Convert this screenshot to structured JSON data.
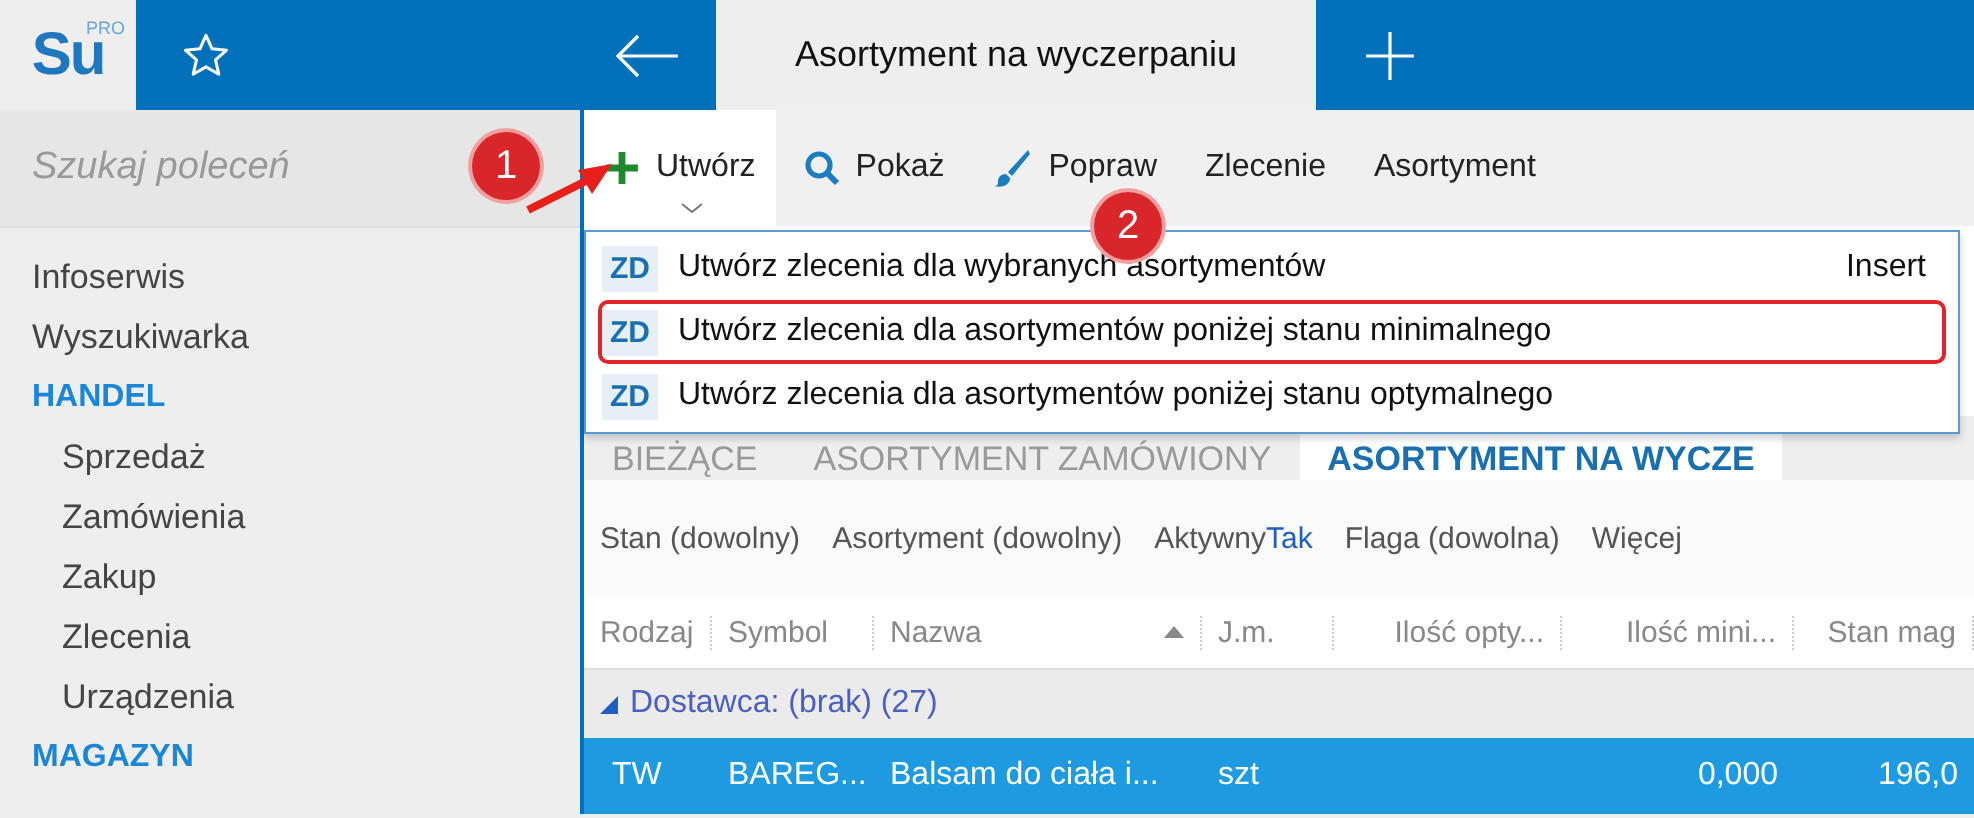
{
  "header": {
    "logo": "Su",
    "logo_badge": "PRO",
    "tab_title": "Asortyment na wyczerpaniu"
  },
  "sidebar": {
    "search": {
      "placeholder": "Szukaj poleceń"
    },
    "items": [
      {
        "kind": "link",
        "label": "Infoserwis"
      },
      {
        "kind": "link",
        "label": "Wyszukiwarka"
      },
      {
        "kind": "section",
        "label": "HANDEL"
      },
      {
        "kind": "sub",
        "label": "Sprzedaż"
      },
      {
        "kind": "sub",
        "label": "Zamówienia"
      },
      {
        "kind": "sub",
        "label": "Zakup"
      },
      {
        "kind": "sub",
        "label": "Zlecenia"
      },
      {
        "kind": "sub",
        "label": "Urządzenia"
      },
      {
        "kind": "section",
        "label": "MAGAZYN"
      }
    ]
  },
  "toolbar": [
    {
      "kind": "plus",
      "label": "Utwórz",
      "expanded": true
    },
    {
      "kind": "search",
      "label": "Pokaż",
      "expanded": false
    },
    {
      "kind": "brush",
      "label": "Popraw",
      "expanded": false
    },
    {
      "kind": "text",
      "label": "Zlecenie",
      "expanded": false
    },
    {
      "kind": "text",
      "label": "Asortyment",
      "expanded": false
    }
  ],
  "menu": [
    {
      "code": "ZD",
      "label": "Utwórz zlecenia dla wybranych asortymentów",
      "shortcut": "Insert",
      "highlighted": false
    },
    {
      "code": "ZD",
      "label": "Utwórz zlecenia dla asortymentów poniżej stanu minimalnego",
      "highlighted": true
    },
    {
      "code": "ZD",
      "label": "Utwórz zlecenia dla asortymentów poniżej stanu optymalnego",
      "highlighted": false
    }
  ],
  "callouts": [
    "1",
    "2"
  ],
  "tabs": [
    {
      "label": "BIEŻĄCE",
      "selected": false
    },
    {
      "label": "ASORTYMENT ZAMÓWIONY",
      "selected": false
    },
    {
      "label": "ASORTYMENT NA WYCZE",
      "selected": true
    }
  ],
  "filters": [
    {
      "label": "Stan (dowolny)"
    },
    {
      "label": "Asortyment (dowolny)"
    },
    {
      "label": "Aktywny",
      "value": "Tak"
    },
    {
      "label": "Flaga (dowolna)"
    },
    {
      "label": "Więcej"
    }
  ],
  "table": {
    "columns": [
      {
        "label": "Rodzaj"
      },
      {
        "label": "Symbol"
      },
      {
        "label": "Nazwa",
        "sorted": true
      },
      {
        "label": "J.m."
      },
      {
        "label": "Ilość opty..."
      },
      {
        "label": "Ilość mini..."
      },
      {
        "label": "Stan mag"
      }
    ],
    "group": {
      "label": "Dostawca: (brak) (27)",
      "expanded": true
    },
    "rows": [
      {
        "selected": true,
        "cells": [
          "TW",
          "BAREG...",
          "Balsam do ciała i...",
          "szt",
          "",
          "0,000",
          "196,0"
        ]
      }
    ]
  }
}
